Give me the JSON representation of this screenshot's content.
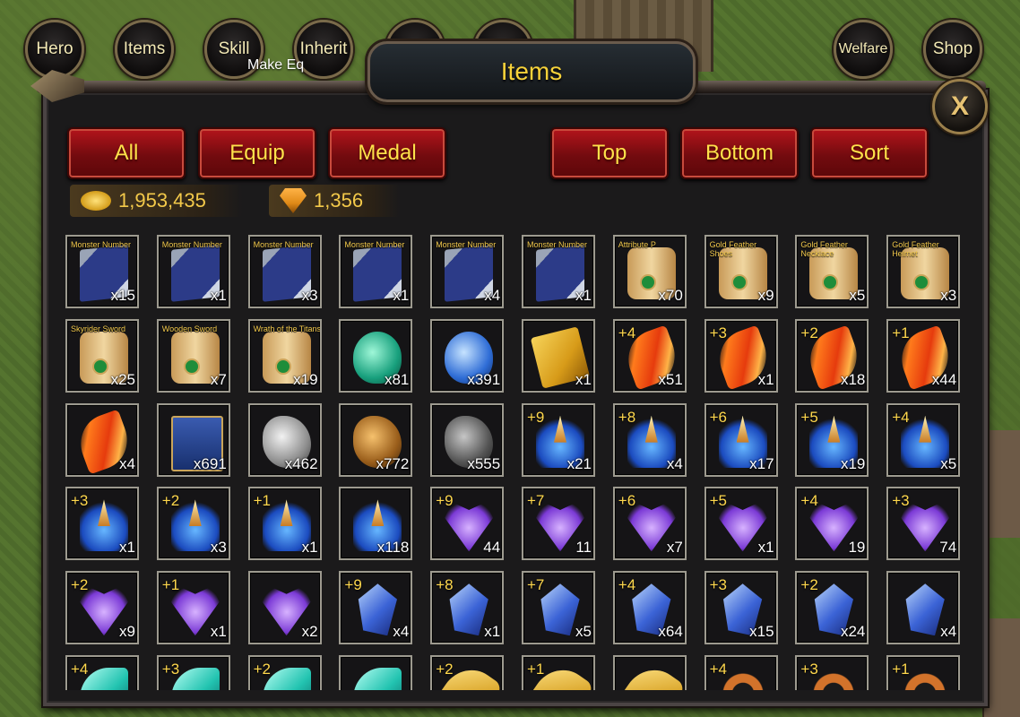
{
  "nav": {
    "hero": "Hero",
    "items": "Items",
    "skill": "Skill",
    "inherit": "Inherit",
    "welfare": "Welfare",
    "shop": "Shop",
    "partial_text": "Make Eq"
  },
  "panel": {
    "title": "Items",
    "close_label": "X"
  },
  "filters": {
    "all": "All",
    "equip": "Equip",
    "medal": "Medal",
    "top": "Top",
    "bottom": "Bottom",
    "sort": "Sort"
  },
  "currency": {
    "gold": "1,953,435",
    "gems": "1,356"
  },
  "items": [
    {
      "name": "Monster Number",
      "lvl": "",
      "qty": "x15",
      "art": "book"
    },
    {
      "name": "Monster Number",
      "lvl": "",
      "qty": "x1",
      "art": "book"
    },
    {
      "name": "Monster Number",
      "lvl": "",
      "qty": "x3",
      "art": "book"
    },
    {
      "name": "Monster Number",
      "lvl": "",
      "qty": "x1",
      "art": "book"
    },
    {
      "name": "Monster Number",
      "lvl": "",
      "qty": "x4",
      "art": "book"
    },
    {
      "name": "Monster Number",
      "lvl": "",
      "qty": "x1",
      "art": "book"
    },
    {
      "name": "Attribute P",
      "lvl": "",
      "qty": "x70",
      "art": "scroll"
    },
    {
      "name": "Gold Feather Shoes",
      "lvl": "",
      "qty": "x9",
      "art": "scroll"
    },
    {
      "name": "Gold Feather Necklace",
      "lvl": "",
      "qty": "x5",
      "art": "scroll"
    },
    {
      "name": "Gold Feather Helmet",
      "lvl": "",
      "qty": "x3",
      "art": "scroll"
    },
    {
      "name": "Skyrider Sword",
      "lvl": "",
      "qty": "x25",
      "art": "scroll"
    },
    {
      "name": "Wooden Sword",
      "lvl": "",
      "qty": "x7",
      "art": "scroll"
    },
    {
      "name": "Wrath of the Titans",
      "lvl": "",
      "qty": "x19",
      "art": "scroll"
    },
    {
      "name": "",
      "lvl": "",
      "qty": "x81",
      "art": "potion-g"
    },
    {
      "name": "",
      "lvl": "",
      "qty": "x391",
      "art": "potion-b"
    },
    {
      "name": "",
      "lvl": "",
      "qty": "x1",
      "art": "ticket"
    },
    {
      "name": "",
      "lvl": "+4",
      "qty": "x51",
      "art": "feather"
    },
    {
      "name": "",
      "lvl": "+3",
      "qty": "x1",
      "art": "feather"
    },
    {
      "name": "",
      "lvl": "+2",
      "qty": "x18",
      "art": "feather"
    },
    {
      "name": "",
      "lvl": "+1",
      "qty": "x44",
      "art": "feather"
    },
    {
      "name": "",
      "lvl": "",
      "qty": "x4",
      "art": "feather"
    },
    {
      "name": "",
      "lvl": "",
      "qty": "x691",
      "art": "banner"
    },
    {
      "name": "",
      "lvl": "",
      "qty": "x462",
      "art": "ore-w"
    },
    {
      "name": "",
      "lvl": "",
      "qty": "x772",
      "art": "ore-y"
    },
    {
      "name": "",
      "lvl": "",
      "qty": "x555",
      "art": "ore-d"
    },
    {
      "name": "",
      "lvl": "+9",
      "qty": "x21",
      "art": "crystal-b"
    },
    {
      "name": "",
      "lvl": "+8",
      "qty": "x4",
      "art": "crystal-b"
    },
    {
      "name": "",
      "lvl": "+6",
      "qty": "x17",
      "art": "crystal-b"
    },
    {
      "name": "",
      "lvl": "+5",
      "qty": "x19",
      "art": "crystal-b"
    },
    {
      "name": "",
      "lvl": "+4",
      "qty": "x5",
      "art": "crystal-b"
    },
    {
      "name": "",
      "lvl": "+3",
      "qty": "x1",
      "art": "crystal-b"
    },
    {
      "name": "",
      "lvl": "+2",
      "qty": "x3",
      "art": "crystal-b"
    },
    {
      "name": "",
      "lvl": "+1",
      "qty": "x1",
      "art": "crystal-b"
    },
    {
      "name": "",
      "lvl": "",
      "qty": "x118",
      "art": "crystal-b"
    },
    {
      "name": "",
      "lvl": "+9",
      "qty": "44",
      "art": "heart"
    },
    {
      "name": "",
      "lvl": "+7",
      "qty": "11",
      "art": "heart"
    },
    {
      "name": "",
      "lvl": "+6",
      "qty": "x7",
      "art": "heart"
    },
    {
      "name": "",
      "lvl": "+5",
      "qty": "x1",
      "art": "heart"
    },
    {
      "name": "",
      "lvl": "+4",
      "qty": "19",
      "art": "heart"
    },
    {
      "name": "",
      "lvl": "+3",
      "qty": "74",
      "art": "heart"
    },
    {
      "name": "",
      "lvl": "+2",
      "qty": "x9",
      "art": "heart"
    },
    {
      "name": "",
      "lvl": "+1",
      "qty": "x1",
      "art": "heart"
    },
    {
      "name": "",
      "lvl": "",
      "qty": "x2",
      "art": "heart"
    },
    {
      "name": "",
      "lvl": "+9",
      "qty": "x4",
      "art": "shard"
    },
    {
      "name": "",
      "lvl": "+8",
      "qty": "x1",
      "art": "shard"
    },
    {
      "name": "",
      "lvl": "+7",
      "qty": "x5",
      "art": "shard"
    },
    {
      "name": "",
      "lvl": "+4",
      "qty": "x64",
      "art": "shard"
    },
    {
      "name": "",
      "lvl": "+3",
      "qty": "x15",
      "art": "shard"
    },
    {
      "name": "",
      "lvl": "+2",
      "qty": "x24",
      "art": "shard"
    },
    {
      "name": "",
      "lvl": "",
      "qty": "x4",
      "art": "shard"
    },
    {
      "name": "",
      "lvl": "+4",
      "qty": "",
      "art": "leaf"
    },
    {
      "name": "",
      "lvl": "+3",
      "qty": "",
      "art": "leaf"
    },
    {
      "name": "",
      "lvl": "+2",
      "qty": "",
      "art": "leaf"
    },
    {
      "name": "",
      "lvl": "",
      "qty": "",
      "art": "leaf"
    },
    {
      "name": "",
      "lvl": "+2",
      "qty": "",
      "art": "horn"
    },
    {
      "name": "",
      "lvl": "+1",
      "qty": "",
      "art": "horn"
    },
    {
      "name": "",
      "lvl": "",
      "qty": "",
      "art": "horn"
    },
    {
      "name": "",
      "lvl": "+4",
      "qty": "",
      "art": "ring"
    },
    {
      "name": "",
      "lvl": "+3",
      "qty": "",
      "art": "ring"
    },
    {
      "name": "",
      "lvl": "+1",
      "qty": "",
      "art": "ring"
    }
  ]
}
